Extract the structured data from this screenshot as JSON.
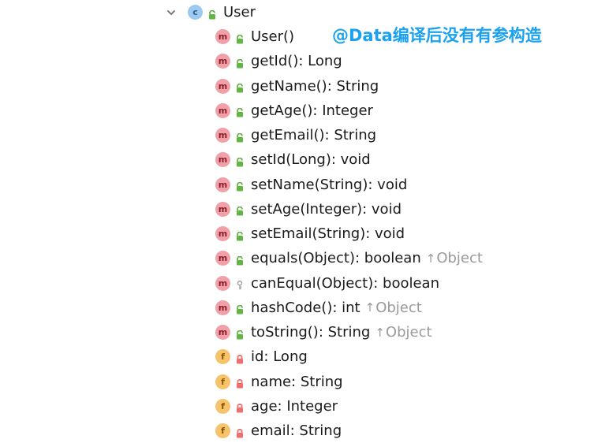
{
  "tree": {
    "root": {
      "label": "User",
      "badge": "c",
      "expanded": true
    },
    "members": [
      {
        "badge": "m",
        "visibility": "public",
        "label": "User()",
        "inherited_from": ""
      },
      {
        "badge": "m",
        "visibility": "public",
        "label": "getId(): Long",
        "inherited_from": ""
      },
      {
        "badge": "m",
        "visibility": "public",
        "label": "getName(): String",
        "inherited_from": ""
      },
      {
        "badge": "m",
        "visibility": "public",
        "label": "getAge(): Integer",
        "inherited_from": ""
      },
      {
        "badge": "m",
        "visibility": "public",
        "label": "getEmail(): String",
        "inherited_from": ""
      },
      {
        "badge": "m",
        "visibility": "public",
        "label": "setId(Long): void",
        "inherited_from": ""
      },
      {
        "badge": "m",
        "visibility": "public",
        "label": "setName(String): void",
        "inherited_from": ""
      },
      {
        "badge": "m",
        "visibility": "public",
        "label": "setAge(Integer): void",
        "inherited_from": ""
      },
      {
        "badge": "m",
        "visibility": "public",
        "label": "setEmail(String): void",
        "inherited_from": ""
      },
      {
        "badge": "m",
        "visibility": "public",
        "label": "equals(Object): boolean",
        "inherited_from": "Object"
      },
      {
        "badge": "m",
        "visibility": "protected",
        "label": "canEqual(Object): boolean",
        "inherited_from": ""
      },
      {
        "badge": "m",
        "visibility": "public",
        "label": "hashCode(): int",
        "inherited_from": "Object"
      },
      {
        "badge": "m",
        "visibility": "public",
        "label": "toString(): String",
        "inherited_from": "Object"
      },
      {
        "badge": "f",
        "visibility": "private",
        "label": "id: Long",
        "inherited_from": ""
      },
      {
        "badge": "f",
        "visibility": "private",
        "label": "name: String",
        "inherited_from": ""
      },
      {
        "badge": "f",
        "visibility": "private",
        "label": "age: Integer",
        "inherited_from": ""
      },
      {
        "badge": "f",
        "visibility": "private",
        "label": "email: String",
        "inherited_from": ""
      }
    ]
  },
  "annotation": {
    "text": "@Data编译后没有有参构造"
  },
  "colors": {
    "note": "#1aa1f0",
    "class_badge": "#9ec9ee",
    "method_badge": "#f2a0a7",
    "field_badge": "#f6c36b",
    "public_lock": "#62b543",
    "private_lock": "#f26d6d",
    "protected_key": "#a3a3a3",
    "inherited_text": "#9a9a9a"
  }
}
